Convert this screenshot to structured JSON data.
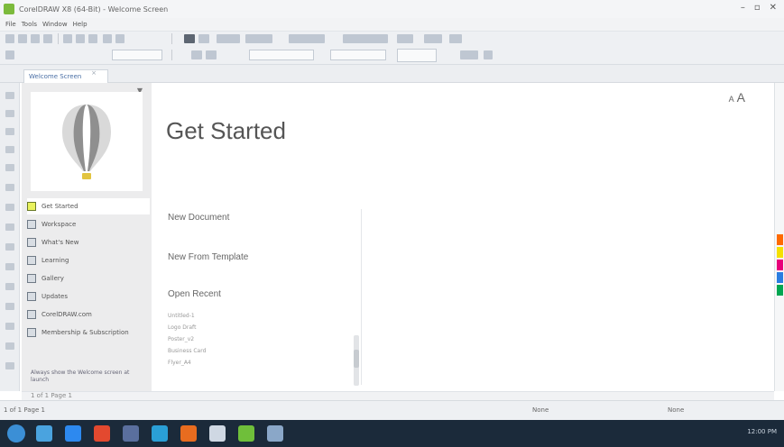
{
  "titlebar": {
    "title": "CorelDRAW X8 (64-Bit) - Welcome Screen",
    "controls": [
      "–",
      "▫",
      "✕"
    ]
  },
  "menubar": {
    "items": [
      "File",
      "Tools",
      "Window",
      "Help"
    ]
  },
  "tabs": {
    "welcome": "Welcome Screen",
    "close": "×"
  },
  "sidepanel": {
    "pin": "▼",
    "nav": [
      {
        "label": "Get Started",
        "icon": "start-icon",
        "active": true
      },
      {
        "label": "Workspace",
        "icon": "workspace-icon",
        "active": false
      },
      {
        "label": "What's New",
        "icon": "whats-new-icon",
        "active": false
      },
      {
        "label": "Learning",
        "icon": "learning-icon",
        "active": false
      },
      {
        "label": "Gallery",
        "icon": "gallery-icon",
        "active": false
      },
      {
        "label": "Updates",
        "icon": "updates-icon",
        "active": false
      },
      {
        "label": "CorelDRAW.com",
        "icon": "web-icon",
        "active": false
      },
      {
        "label": "Membership & Subscription",
        "icon": "membership-icon",
        "active": false
      }
    ],
    "note": "Always show the Welcome screen at launch"
  },
  "main": {
    "title": "Get Started",
    "font_control_small": "A",
    "font_control_large": "A",
    "actions": {
      "new_document": "New Document",
      "new_from_template": "New From Template",
      "open_recent": "Open Recent"
    },
    "recent": [
      "Untitled-1",
      "Logo Draft",
      "Poster_v2",
      "Business Card",
      "Flyer_A4"
    ]
  },
  "pagenav": {
    "text": "1 of 1   Page 1"
  },
  "statusbar": {
    "left": "1 of 1   Page 1",
    "mid": "None",
    "right": "None"
  },
  "palette_colors": [
    "#ff6a00",
    "#f5e000",
    "#e8007a",
    "#2a7de1",
    "#00a651"
  ],
  "taskbar": {
    "tray": "12:00 PM"
  }
}
